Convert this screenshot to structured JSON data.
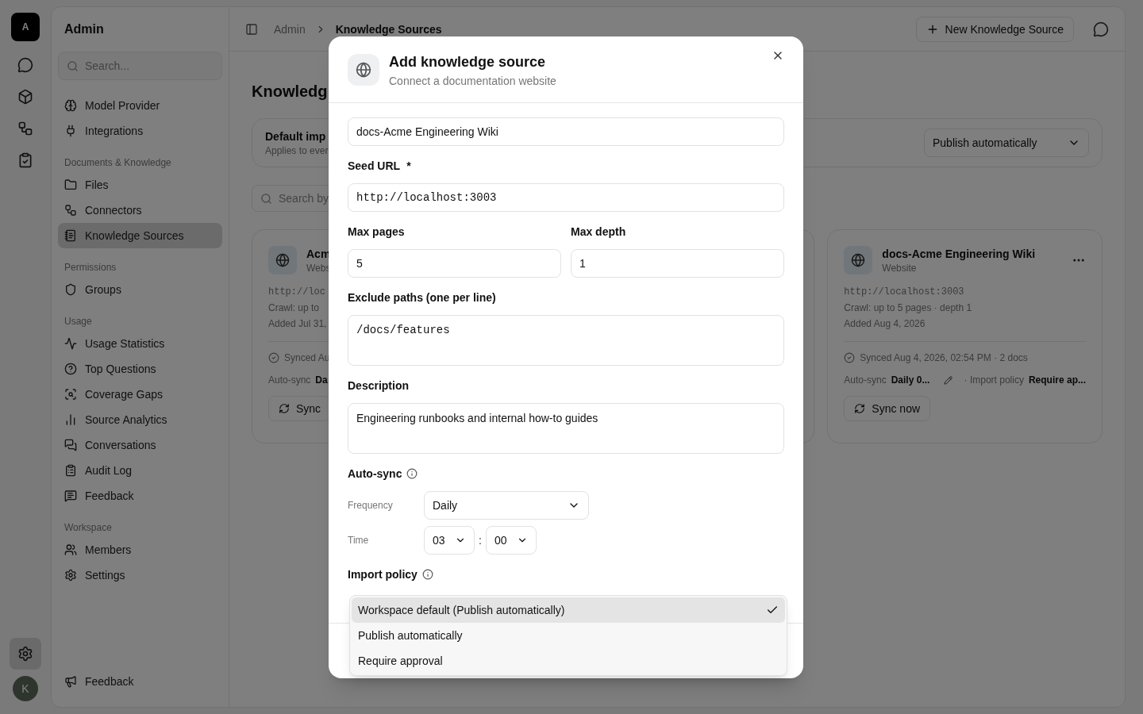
{
  "rail": {
    "logo": "A",
    "settings": {
      "selected": true
    },
    "avatar": "K"
  },
  "sidebar": {
    "title": "Admin",
    "search_placeholder": "Search...",
    "sections": [
      {
        "items": [
          {
            "label": "Model Provider",
            "selected": false
          },
          {
            "label": "Integrations",
            "selected": false
          }
        ]
      },
      {
        "heading": "Documents & Knowledge",
        "items": [
          {
            "label": "Files",
            "selected": false
          },
          {
            "label": "Connectors",
            "selected": false
          },
          {
            "label": "Knowledge Sources",
            "selected": true
          }
        ]
      },
      {
        "heading": "Permissions",
        "items": [
          {
            "label": "Groups",
            "selected": false
          }
        ]
      },
      {
        "heading": "Usage",
        "items": [
          {
            "label": "Usage Statistics",
            "selected": false
          },
          {
            "label": "Top Questions",
            "selected": false
          },
          {
            "label": "Coverage Gaps",
            "selected": false
          },
          {
            "label": "Source Analytics",
            "selected": false
          },
          {
            "label": "Conversations",
            "selected": false
          },
          {
            "label": "Audit Log",
            "selected": false
          },
          {
            "label": "Feedback",
            "selected": false
          }
        ]
      },
      {
        "heading": "Workspace",
        "items": [
          {
            "label": "Members",
            "selected": false
          },
          {
            "label": "Settings",
            "selected": false
          }
        ]
      }
    ],
    "footer_item": "Feedback"
  },
  "breadcrumb": [
    "Admin",
    "Knowledge Sources"
  ],
  "new_button": "New Knowledge Source",
  "page_title": "Knowledg",
  "default_policy": {
    "title": "Default imp",
    "subtitle": "Applies to ever",
    "value": "Publish automatically"
  },
  "search_placeholder": "Search by",
  "cards": [
    {
      "name": "Acm",
      "type": "Webs",
      "url": "http://loc",
      "crawl": "Crawl: up to",
      "added": "Added Jul 31,",
      "synced": "Synced Au",
      "autosync_label": "Auto-sync",
      "autosync_value": "Da",
      "sync_button": "Sync"
    },
    {
      "name": "docs-Acme Engineering Wiki",
      "type": "Website",
      "url": "http://localhost:3003",
      "crawl": "Crawl: up to 5 pages · depth 1",
      "added": "Added Aug 4, 2026",
      "synced": "Synced Aug 4, 2026, 02:54 PM · 2 docs",
      "autosync_label": "Auto-sync",
      "autosync_value": "Daily 0...",
      "policy_label": "· Import policy",
      "policy_value": "Require ap...",
      "sync_button": "Sync now"
    }
  ],
  "modal": {
    "title": "Add knowledge source",
    "subtitle": "Connect a documentation website",
    "name_value": "docs-Acme Engineering Wiki",
    "seed_label": "Seed URL",
    "required_mark": "*",
    "seed_value": "http://localhost:3003",
    "max_pages_label": "Max pages",
    "max_pages": "5",
    "max_depth_label": "Max depth",
    "max_depth": "1",
    "exclude_label": "Exclude paths (one per line)",
    "exclude_value": "/docs/features",
    "description_label": "Description",
    "description_value": "Engineering runbooks and internal how-to guides",
    "autosync_label": "Auto-sync",
    "frequency_label": "Frequency",
    "frequency": "Daily",
    "time_label": "Time",
    "hour": "03",
    "separator": ":",
    "minute": "00",
    "policy_label": "Import policy",
    "policy_options": [
      {
        "label": "Workspace default (Publish automatically)",
        "selected": true
      },
      {
        "label": "Publish automatically",
        "selected": false
      },
      {
        "label": "Require approval",
        "selected": false
      }
    ]
  }
}
